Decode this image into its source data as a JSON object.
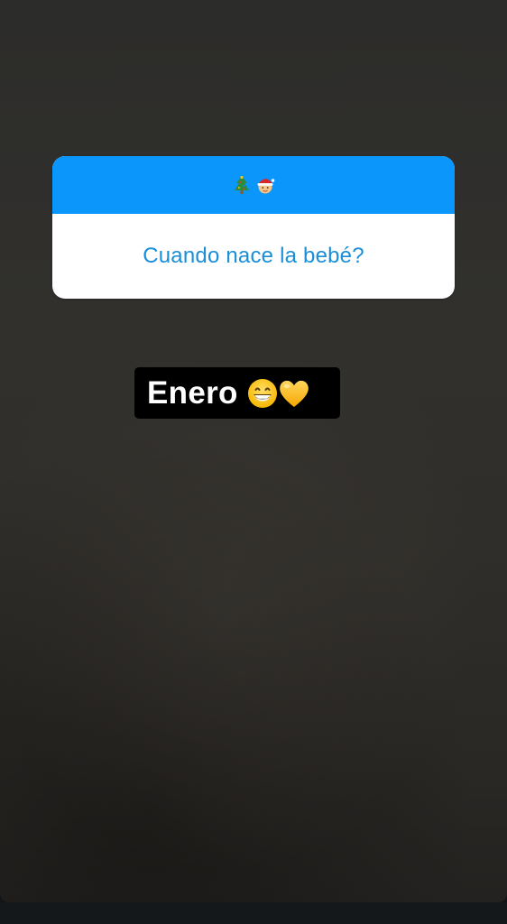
{
  "question_sticker": {
    "header_icons": [
      "christmas-tree-icon",
      "santa-baby-icon"
    ],
    "question": "Cuando nace la bebé?",
    "colors": {
      "header": "#0a96fa",
      "question_text": "#1a8fd8",
      "card_background": "#ffffff"
    }
  },
  "answer_sticker": {
    "text": "Enero",
    "emojis": [
      "grinning-face-icon",
      "yellow-heart-icon"
    ],
    "colors": {
      "background": "#000000",
      "text": "#ffffff"
    }
  }
}
